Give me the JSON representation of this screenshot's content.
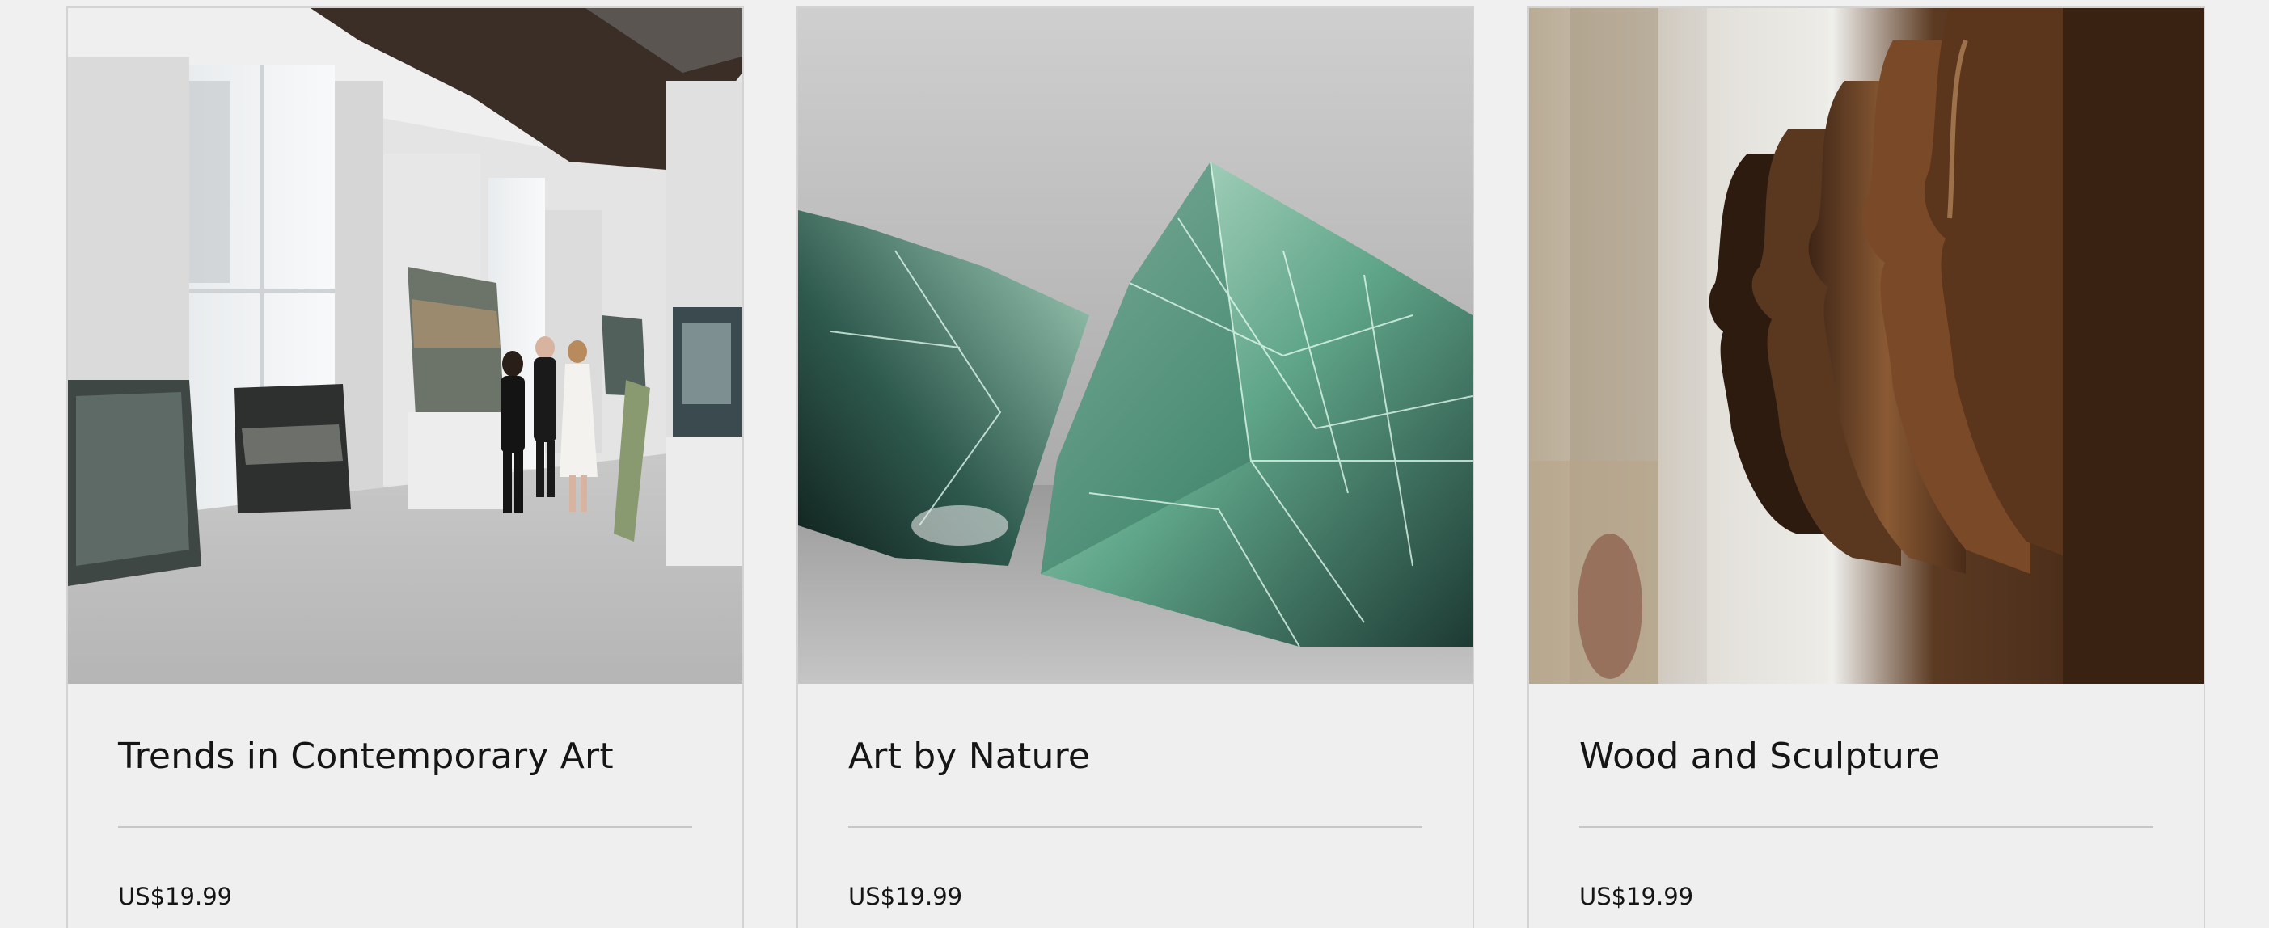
{
  "products": [
    {
      "title": "Trends in Contemporary Art",
      "price": "US$19.99",
      "image_alt": "Gallery with visitors viewing abstract paintings"
    },
    {
      "title": "Art by Nature",
      "price": "US$19.99",
      "image_alt": "Cracked green glass sculpture"
    },
    {
      "title": "Wood and Sculpture",
      "price": "US$19.99",
      "image_alt": "Carved wooden profile sculptures"
    }
  ],
  "colors": {
    "background": "#f0f0f0",
    "card_border": "#d3d3d3",
    "divider": "#c6c6c6",
    "text": "#151515"
  }
}
